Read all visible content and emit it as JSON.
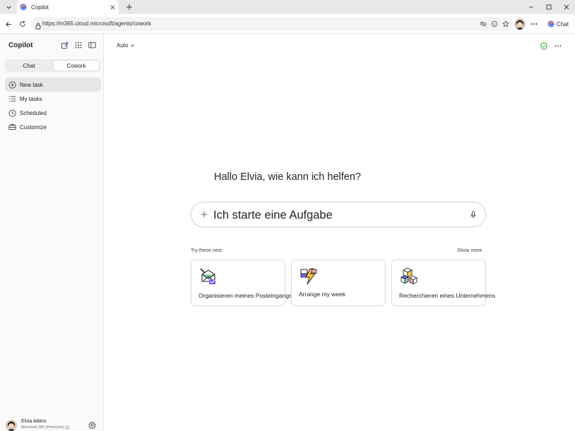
{
  "browser": {
    "tab_title": "Copilot",
    "url": "https://m365.cloud.microsoft/agents/cowork",
    "chat_label": "Chat"
  },
  "sidebar": {
    "title": "Copilot",
    "segments": [
      "Chat",
      "Cowork"
    ],
    "active_segment": "Cowork",
    "items": [
      {
        "label": "New task",
        "icon": "plus-circle-icon"
      },
      {
        "label": "My tasks",
        "icon": "list-icon"
      },
      {
        "label": "Scheduled",
        "icon": "clock-icon"
      },
      {
        "label": "Customize",
        "icon": "briefcase-icon"
      }
    ],
    "user": {
      "name": "Elvia Atkins",
      "plan": "Microsoft 365 (Premium)"
    }
  },
  "main": {
    "model_label": "Auto",
    "greeting": "Hallo Elvia, wie kann ich helfen?",
    "composer_placeholder": "Ich starte eine Aufgabe",
    "try_label": "Try these next",
    "show_more": "Show more",
    "cards": [
      {
        "label": "Organisieren meines Posteingangs"
      },
      {
        "label": "Arrange my week"
      },
      {
        "label": "Recherchieren eines Unternehmens"
      }
    ]
  },
  "colors": {
    "accent_green": "#13a10e",
    "active_nav": "#e6e6e6"
  }
}
